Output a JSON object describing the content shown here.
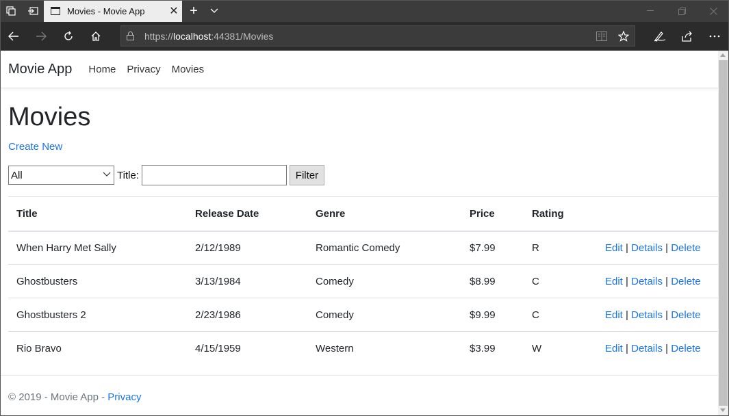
{
  "browser": {
    "tab_title": "Movies - Movie App",
    "url_prefix": "https://",
    "url_host": "localhost",
    "url_rest": ":44381/Movies"
  },
  "app": {
    "brand": "Movie App",
    "nav": [
      "Home",
      "Privacy",
      "Movies"
    ]
  },
  "main": {
    "title": "Movies",
    "create_new": "Create New",
    "filter": {
      "genre_selected": "All",
      "title_label": "Title:",
      "title_value": "",
      "button": "Filter"
    },
    "table": {
      "headers": [
        "Title",
        "Release Date",
        "Genre",
        "Price",
        "Rating"
      ],
      "rows": [
        {
          "title": "When Harry Met Sally",
          "release": "2/12/1989",
          "genre": "Romantic Comedy",
          "price": "$7.99",
          "rating": "R"
        },
        {
          "title": "Ghostbusters",
          "release": "3/13/1984",
          "genre": "Comedy",
          "price": "$8.99",
          "rating": "C"
        },
        {
          "title": "Ghostbusters 2",
          "release": "2/23/1986",
          "genre": "Comedy",
          "price": "$9.99",
          "rating": "C"
        },
        {
          "title": "Rio Bravo",
          "release": "4/15/1959",
          "genre": "Western",
          "price": "$3.99",
          "rating": "W"
        }
      ],
      "actions": {
        "edit": "Edit",
        "details": "Details",
        "delete": "Delete",
        "separator": "|"
      }
    }
  },
  "footer": {
    "text": "© 2019 - Movie App - ",
    "privacy": "Privacy"
  },
  "colors": {
    "link": "#1b73e8",
    "browser_chrome": "#2b2b2b"
  }
}
